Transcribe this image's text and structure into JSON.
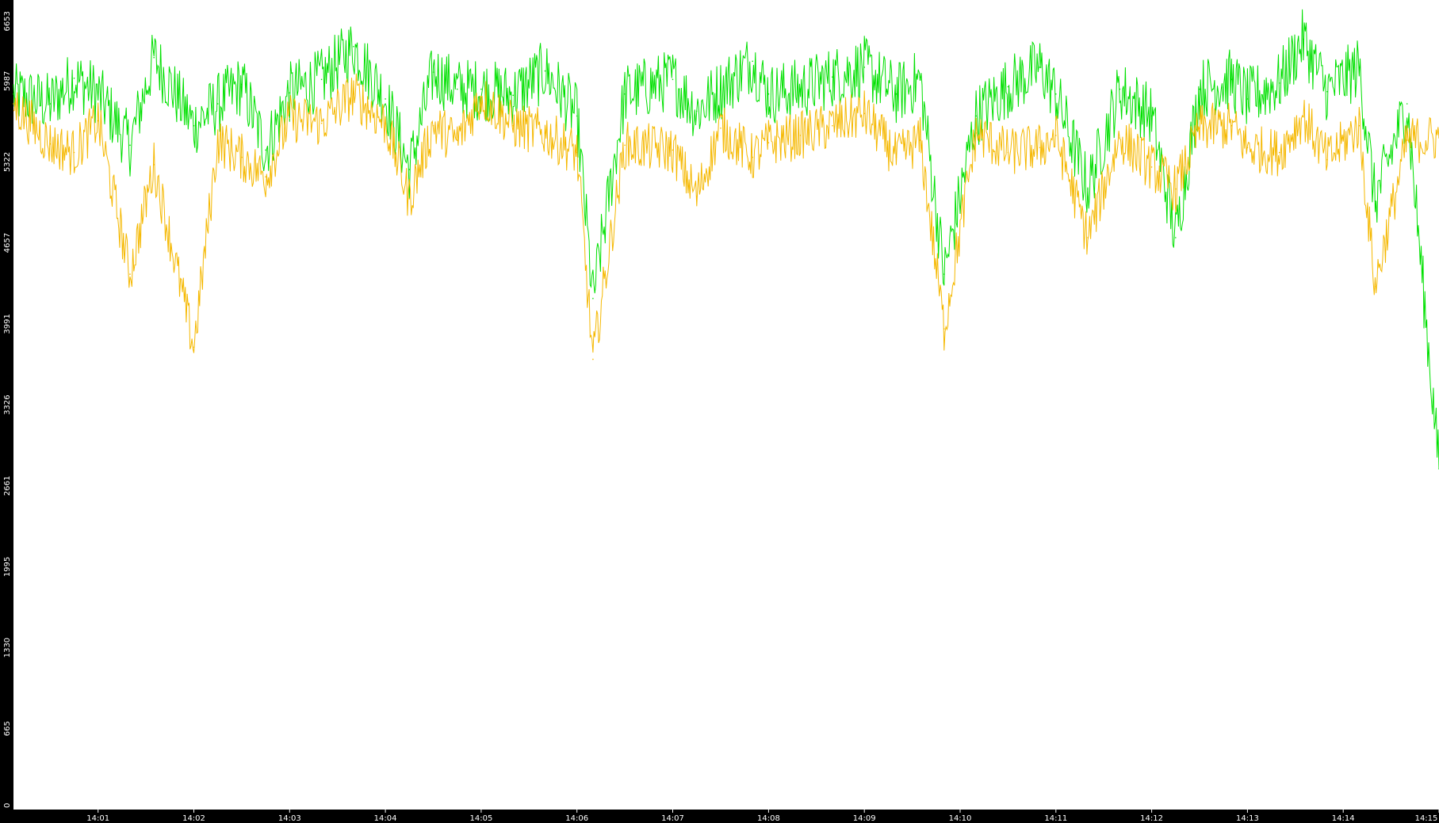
{
  "chart_data": {
    "type": "line",
    "title": "",
    "xlabel": "",
    "ylabel": "",
    "ylim": [
      0,
      6653
    ],
    "y_ticks": [
      "0",
      "665",
      "1330",
      "1995",
      "2661",
      "3326",
      "3991",
      "4657",
      "5322",
      "5987",
      "6653"
    ],
    "x_ticks": [
      "14:01",
      "14:02",
      "14:03",
      "14:04",
      "14:05",
      "14:06",
      "14:07",
      "14:08",
      "14:09",
      "14:10",
      "14:11",
      "14:12",
      "14:13",
      "14:14",
      "14:15"
    ],
    "xlim": [
      "14:00:07",
      "14:15:00"
    ],
    "grid": false,
    "legend": "none",
    "background": "#ffffff",
    "frame_color": "#000000",
    "series": [
      {
        "color": "#00e000",
        "x": [
          "14:00:07",
          "14:00:30",
          "14:00:45",
          "14:01:00",
          "14:01:20",
          "14:01:35",
          "14:02:00",
          "14:02:15",
          "14:02:30",
          "14:02:45",
          "14:03:00",
          "14:03:20",
          "14:03:40",
          "14:04:00",
          "14:04:15",
          "14:04:30",
          "14:04:45",
          "14:05:00",
          "14:05:20",
          "14:05:40",
          "14:06:00",
          "14:06:10",
          "14:06:30",
          "14:07:00",
          "14:07:15",
          "14:07:30",
          "14:07:50",
          "14:08:00",
          "14:08:20",
          "14:08:40",
          "14:09:00",
          "14:09:20",
          "14:09:35",
          "14:09:50",
          "14:10:10",
          "14:10:30",
          "14:10:50",
          "14:11:00",
          "14:11:20",
          "14:11:40",
          "14:12:00",
          "14:12:15",
          "14:12:30",
          "14:12:50",
          "14:13:00",
          "14:13:20",
          "14:13:35",
          "14:13:50",
          "14:14:10",
          "14:14:20",
          "14:14:40",
          "14:15:00"
        ],
        "values": [
          5880,
          5800,
          6010,
          5880,
          5460,
          6180,
          5620,
          5800,
          5960,
          5420,
          5890,
          6000,
          6270,
          5840,
          5260,
          6060,
          5920,
          5920,
          5870,
          6070,
          5700,
          4200,
          5880,
          6000,
          5740,
          5920,
          6150,
          5880,
          5920,
          6020,
          6100,
          5880,
          6000,
          4400,
          5700,
          5940,
          6100,
          5880,
          5100,
          5920,
          5700,
          4700,
          5920,
          6000,
          5840,
          5970,
          6330,
          5900,
          6100,
          5000,
          5800,
          2800
        ]
      },
      {
        "color": "#f5b800",
        "x": [
          "14:00:07",
          "14:00:30",
          "14:00:45",
          "14:01:00",
          "14:01:20",
          "14:01:35",
          "14:02:00",
          "14:02:15",
          "14:02:30",
          "14:02:45",
          "14:03:00",
          "14:03:20",
          "14:03:40",
          "14:04:00",
          "14:04:15",
          "14:04:30",
          "14:04:45",
          "14:05:00",
          "14:05:20",
          "14:05:40",
          "14:06:00",
          "14:06:10",
          "14:06:30",
          "14:07:00",
          "14:07:15",
          "14:07:30",
          "14:07:50",
          "14:08:00",
          "14:08:20",
          "14:08:40",
          "14:09:00",
          "14:09:20",
          "14:09:35",
          "14:09:50",
          "14:10:10",
          "14:10:30",
          "14:10:50",
          "14:11:00",
          "14:11:20",
          "14:11:40",
          "14:12:00",
          "14:12:15",
          "14:12:30",
          "14:12:50",
          "14:13:00",
          "14:13:20",
          "14:13:35",
          "14:13:50",
          "14:14:10",
          "14:14:20",
          "14:14:40",
          "14:15:00"
        ],
        "values": [
          5800,
          5470,
          5400,
          5660,
          4400,
          5300,
          3800,
          5500,
          5360,
          5200,
          5680,
          5640,
          5880,
          5640,
          5020,
          5620,
          5500,
          5860,
          5620,
          5560,
          5400,
          3700,
          5460,
          5420,
          5040,
          5600,
          5360,
          5480,
          5540,
          5620,
          5720,
          5360,
          5500,
          3950,
          5560,
          5400,
          5440,
          5540,
          4700,
          5520,
          5280,
          5100,
          5600,
          5620,
          5440,
          5400,
          5700,
          5340,
          5620,
          4300,
          5500,
          5520
        ]
      }
    ]
  }
}
